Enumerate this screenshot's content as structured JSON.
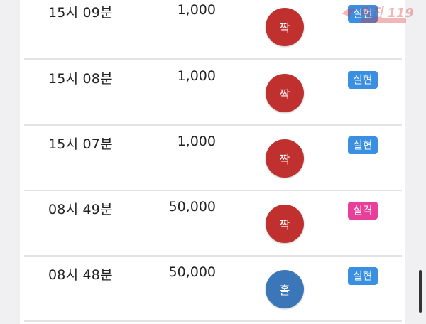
{
  "rows": [
    {
      "time": "15시 09분",
      "amount": "1,000",
      "result": "짝",
      "status": "실현"
    },
    {
      "time": "15시 08분",
      "amount": "1,000",
      "result": "짝",
      "status": "실현"
    },
    {
      "time": "15시 07분",
      "amount": "1,000",
      "result": "짝",
      "status": "실현"
    },
    {
      "time": "08시 49분",
      "amount": "50,000",
      "result": "짝",
      "status": "실격"
    },
    {
      "time": "08시 48분",
      "amount": "50,000",
      "result": "홀",
      "status": "실현"
    }
  ],
  "logo": {
    "text": "먹진 119"
  },
  "colors": {
    "red_ball": "#c0302f",
    "blue_ball": "#3b76b8",
    "badge_blue": "#3a8fe0",
    "badge_pink": "#e8409a"
  }
}
